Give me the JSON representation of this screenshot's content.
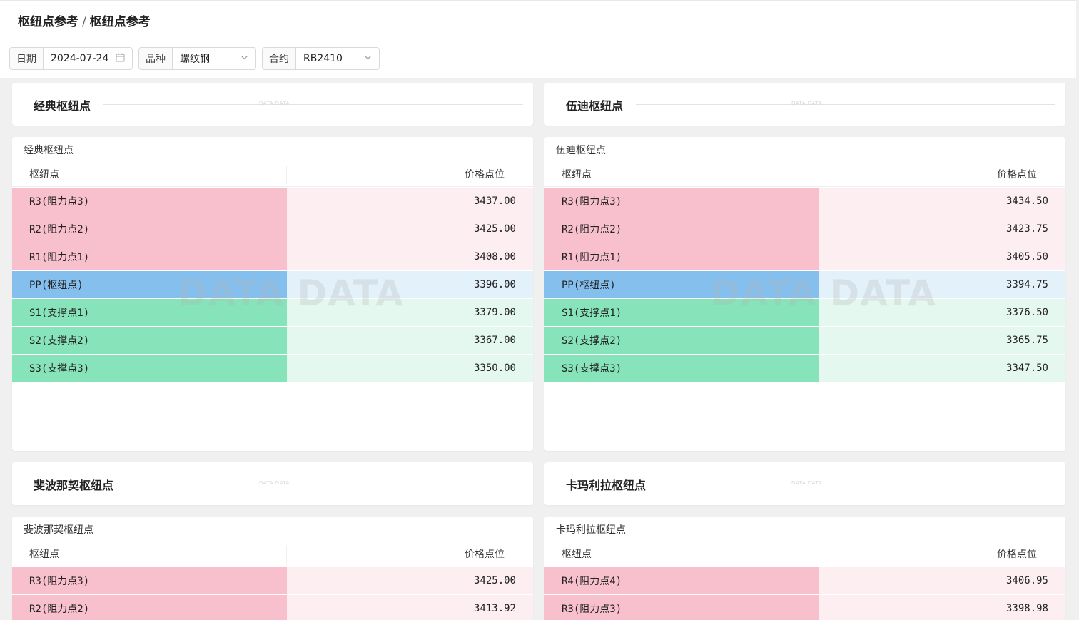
{
  "breadcrumb": {
    "parent": "枢纽点参考",
    "separator": "/",
    "current": "枢纽点参考"
  },
  "filters": {
    "date_label": "日期",
    "date_value": "2024-07-24",
    "date_icon": "calendar-icon",
    "variety_label": "品种",
    "variety_value": "螺纹钢",
    "variety_icon": "chevron-down-icon",
    "contract_label": "合约",
    "contract_value": "RB2410",
    "contract_icon": "chevron-down-icon"
  },
  "watermark": {
    "big": "DATA DATA",
    "small": "DATA DATA"
  },
  "column_headers": {
    "pivot": "枢纽点",
    "price": "价格点位"
  },
  "sections": [
    {
      "title": "经典枢纽点",
      "table_title": "经典枢纽点",
      "rows": [
        {
          "label": "R3(阻力点3)",
          "value": "3437.00",
          "type": "resistance"
        },
        {
          "label": "R2(阻力点2)",
          "value": "3425.00",
          "type": "resistance"
        },
        {
          "label": "R1(阻力点1)",
          "value": "3408.00",
          "type": "resistance"
        },
        {
          "label": "PP(枢纽点)",
          "value": "3396.00",
          "type": "pivot"
        },
        {
          "label": "S1(支撑点1)",
          "value": "3379.00",
          "type": "support"
        },
        {
          "label": "S2(支撑点2)",
          "value": "3367.00",
          "type": "support"
        },
        {
          "label": "S3(支撑点3)",
          "value": "3350.00",
          "type": "support"
        }
      ]
    },
    {
      "title": "伍迪枢纽点",
      "table_title": "伍迪枢纽点",
      "rows": [
        {
          "label": "R3(阻力点3)",
          "value": "3434.50",
          "type": "resistance"
        },
        {
          "label": "R2(阻力点2)",
          "value": "3423.75",
          "type": "resistance"
        },
        {
          "label": "R1(阻力点1)",
          "value": "3405.50",
          "type": "resistance"
        },
        {
          "label": "PP(枢纽点)",
          "value": "3394.75",
          "type": "pivot"
        },
        {
          "label": "S1(支撑点1)",
          "value": "3376.50",
          "type": "support"
        },
        {
          "label": "S2(支撑点2)",
          "value": "3365.75",
          "type": "support"
        },
        {
          "label": "S3(支撑点3)",
          "value": "3347.50",
          "type": "support"
        }
      ]
    },
    {
      "title": "斐波那契枢纽点",
      "table_title": "斐波那契枢纽点",
      "rows": [
        {
          "label": "R3(阻力点3)",
          "value": "3425.00",
          "type": "resistance"
        },
        {
          "label": "R2(阻力点2)",
          "value": "3413.92",
          "type": "resistance"
        }
      ]
    },
    {
      "title": "卡玛利拉枢纽点",
      "table_title": "卡玛利拉枢纽点",
      "rows": [
        {
          "label": "R4(阻力点4)",
          "value": "3406.95",
          "type": "resistance"
        },
        {
          "label": "R3(阻力点3)",
          "value": "3398.98",
          "type": "resistance"
        }
      ]
    }
  ],
  "colors": {
    "resistance_label": "#f8bfcd",
    "resistance_value": "#fdeff1",
    "pivot_label": "#84bfee",
    "pivot_value": "#e3f1fb",
    "support_label": "#86e3ba",
    "support_value": "#e4f8ef"
  }
}
